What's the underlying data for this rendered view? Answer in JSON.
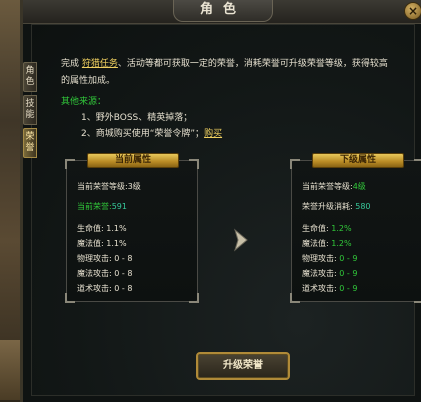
{
  "window": {
    "title": "角色",
    "close_icon": "close-icon"
  },
  "side_tabs": [
    {
      "label": "角色",
      "active": false
    },
    {
      "label": "技能",
      "active": false
    },
    {
      "label": "荣誉",
      "active": true
    }
  ],
  "intro": {
    "text_before": "完成",
    "link1": "狩猎任务",
    "text_after": "、活动等都可获取一定的荣誉，消耗荣誉可升级荣誉等级，获得较高的属性加成。"
  },
  "sources": {
    "title": "其他来源：",
    "item1": "1、野外BOSS、精英掉落；",
    "item2_text": "2、商城购买使用“荣誉令牌”；",
    "item2_link": "购买"
  },
  "current_panel": {
    "header": "当前属性",
    "level_label": "当前荣誉等级:",
    "level_value": "3级",
    "honor_label": "当前荣誉:",
    "honor_value": "591",
    "hp_label": "生命值:",
    "hp_value": "1.1%",
    "mp_label": "魔法值:",
    "mp_value": "1.1%",
    "phys_label": "物理攻击:",
    "phys_value": "0 - 8",
    "magic_label": "魔法攻击:",
    "magic_value": "0 - 8",
    "tao_label": "道术攻击:",
    "tao_value": "0 - 8"
  },
  "next_panel": {
    "header": "下级属性",
    "level_label": "当前荣誉等级:",
    "level_value": "4级",
    "cost_label": "荣誉升级消耗:",
    "cost_value": "580",
    "hp_label": "生命值:",
    "hp_value": "1.2%",
    "mp_label": "魔法值:",
    "mp_value": "1.2%",
    "phys_label": "物理攻击:",
    "phys_value": "0 - 9",
    "magic_label": "魔法攻击:",
    "magic_value": "0 - 9",
    "tao_label": "道术攻击:",
    "tao_value": "0 - 9"
  },
  "upgrade_button": "升级荣誉",
  "colors": {
    "green": "#31c83a",
    "gold": "#f0d060",
    "text": "#e6e0cf"
  }
}
